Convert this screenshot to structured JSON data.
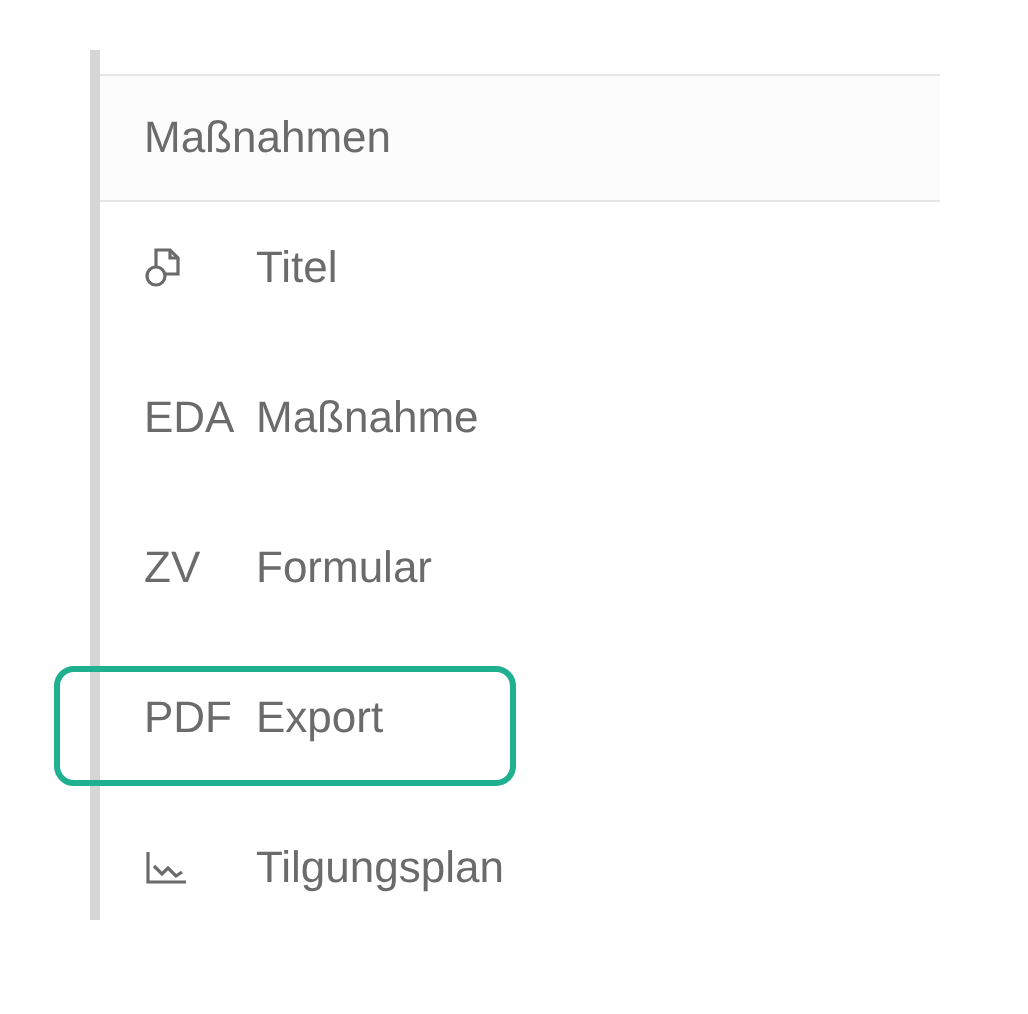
{
  "panel": {
    "title": "Maßnahmen",
    "items": [
      {
        "kind": "shapes",
        "label": "Titel",
        "highlighted": false
      },
      {
        "kind": "text",
        "prefix": "EDA",
        "label": "Maßnahme",
        "highlighted": false
      },
      {
        "kind": "text",
        "prefix": "ZV",
        "label": "Formular",
        "highlighted": false
      },
      {
        "kind": "text",
        "prefix": "PDF",
        "label": "Export",
        "highlighted": true
      },
      {
        "kind": "chart",
        "label": "Tilgungsplan",
        "highlighted": false
      }
    ]
  }
}
